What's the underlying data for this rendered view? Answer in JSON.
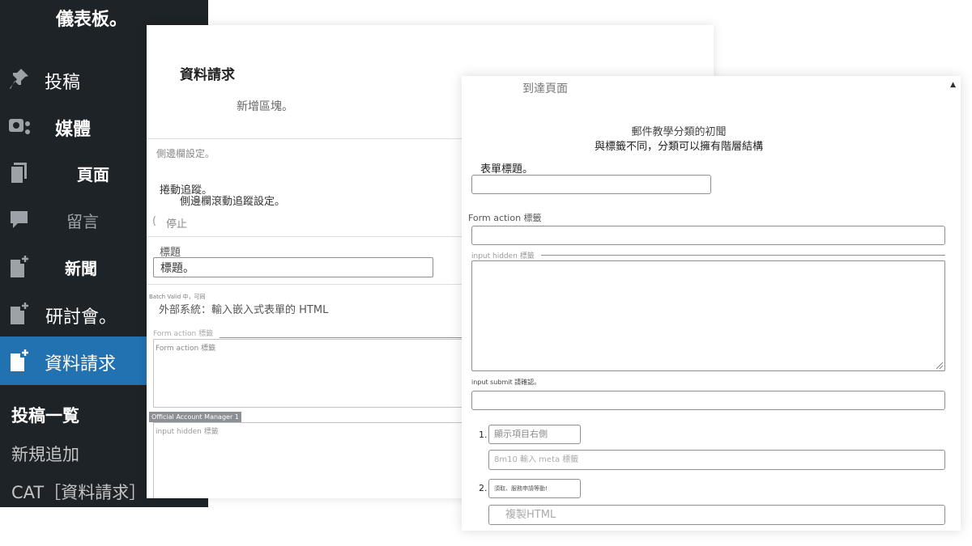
{
  "sidebar": {
    "top_label": "儀表板。",
    "items": [
      {
        "label": "投稿",
        "icon": "pin-icon"
      },
      {
        "label": "媒體",
        "icon": "media-icon"
      },
      {
        "label": "頁面",
        "icon": "pages-icon"
      },
      {
        "label": "留言",
        "icon": "comment-icon"
      },
      {
        "label": "新聞",
        "icon": "post-add-icon"
      },
      {
        "label": "研討會。",
        "icon": "post-add-icon"
      },
      {
        "label": "資料請求",
        "icon": "post-add-icon"
      }
    ],
    "submenu": [
      "投稿一覧",
      "新規追加",
      "CAT［資料請求］"
    ]
  },
  "back_panel": {
    "title": "資料請求",
    "subtitle": "新增區塊。",
    "sidebar_settings": "側邊欄設定。",
    "scroll_tracking": "捲動追蹤。",
    "scroll_tracking_desc": "側邊欄滾動追蹤設定。",
    "stop_label": "停止",
    "heading_label": "標題",
    "heading_value": "標題。",
    "tiny_note": "Batch Valid 中，可同",
    "external_html": "外部系統：輸入嵌入式表單的 HTML",
    "form_action_label": "Form action 標籤",
    "form_action_placeholder": "Form action 標籤",
    "tag_label": "Official Account Manager 1",
    "hidden_placeholder": "input hidden 標籤"
  },
  "front_panel": {
    "header": "到達頁面",
    "caption_1": "郵件教學分類的初聞",
    "caption_2": "與標籤不同，分類可以擁有階層結構",
    "form_title_label": "表單標題。",
    "form_action_label": "Form action 標籤",
    "hidden_label": "input hidden 標籤",
    "submit_label": "input submit 請確認。",
    "items": [
      {
        "number": "1.",
        "field_a": "顯示項目右側",
        "field_b": "8m10 輸入 meta 標籤"
      },
      {
        "number": "2.",
        "field_a": "須取、服務申請等動!",
        "field_b": "複製HTML"
      }
    ]
  }
}
